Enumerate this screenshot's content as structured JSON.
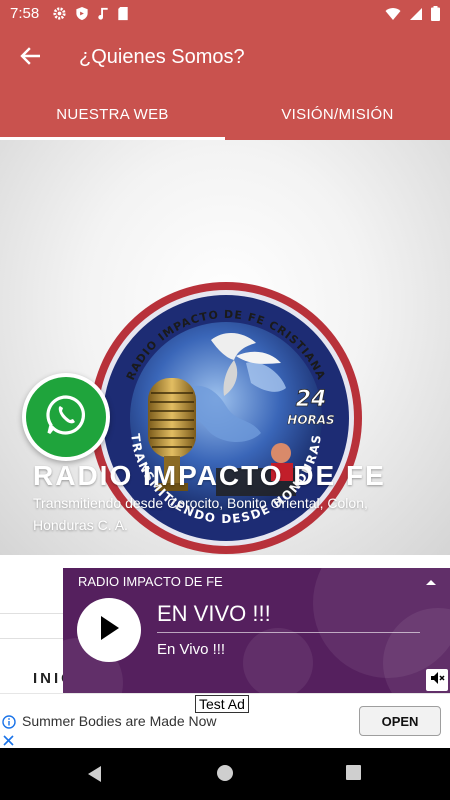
{
  "status_bar": {
    "time": "7:58",
    "left_icons": [
      "gear-icon",
      "shield-icon",
      "music-note-icon",
      "sd-card-icon"
    ],
    "right_icons": [
      "wifi-icon",
      "signal-icon",
      "battery-icon"
    ]
  },
  "app_bar": {
    "title": "¿Quienes Somos?",
    "back_icon": "arrow-left-icon"
  },
  "tabs": [
    {
      "label": "NUESTRA WEB",
      "active": true
    },
    {
      "label": "VISIÓN/MISIÓN",
      "active": false
    }
  ],
  "hero": {
    "title": "RADIO IMPACTO DE FE",
    "subtitle": "Transmitiendo desde Corocito, Bonito Oriental, Colon, Honduras C. A.",
    "logo_top_text": "RADIO IMPACTO DE FE CRISTIANA",
    "logo_bottom_text": "TRANSMITIENDO DESDE HONDURAS",
    "logo_badge": "24",
    "logo_badge_sub": "HORAS"
  },
  "whatsapp": {
    "icon": "whatsapp-icon"
  },
  "section": {
    "label": "INICIO"
  },
  "player": {
    "station": "RADIO IMPACTO DE FE",
    "live_title": "EN VIVO !!!",
    "live_subtitle": "En Vivo !!!",
    "play_icon": "play-icon",
    "collapse_icon": "chevron-up-icon",
    "mute_icon": "speaker-mute-icon"
  },
  "ad": {
    "tag": "Test Ad",
    "text": "Summer Bodies are Made Now",
    "button": "OPEN",
    "info_icon": "info-icon",
    "close_icon": "close-icon"
  },
  "nav_bar": {
    "icons": [
      "back-triangle-icon",
      "home-circle-icon",
      "recents-square-icon"
    ]
  },
  "colors": {
    "app_bar": "#c9524e",
    "player_bg": "#55205e",
    "whatsapp_green": "#1fa43c"
  }
}
